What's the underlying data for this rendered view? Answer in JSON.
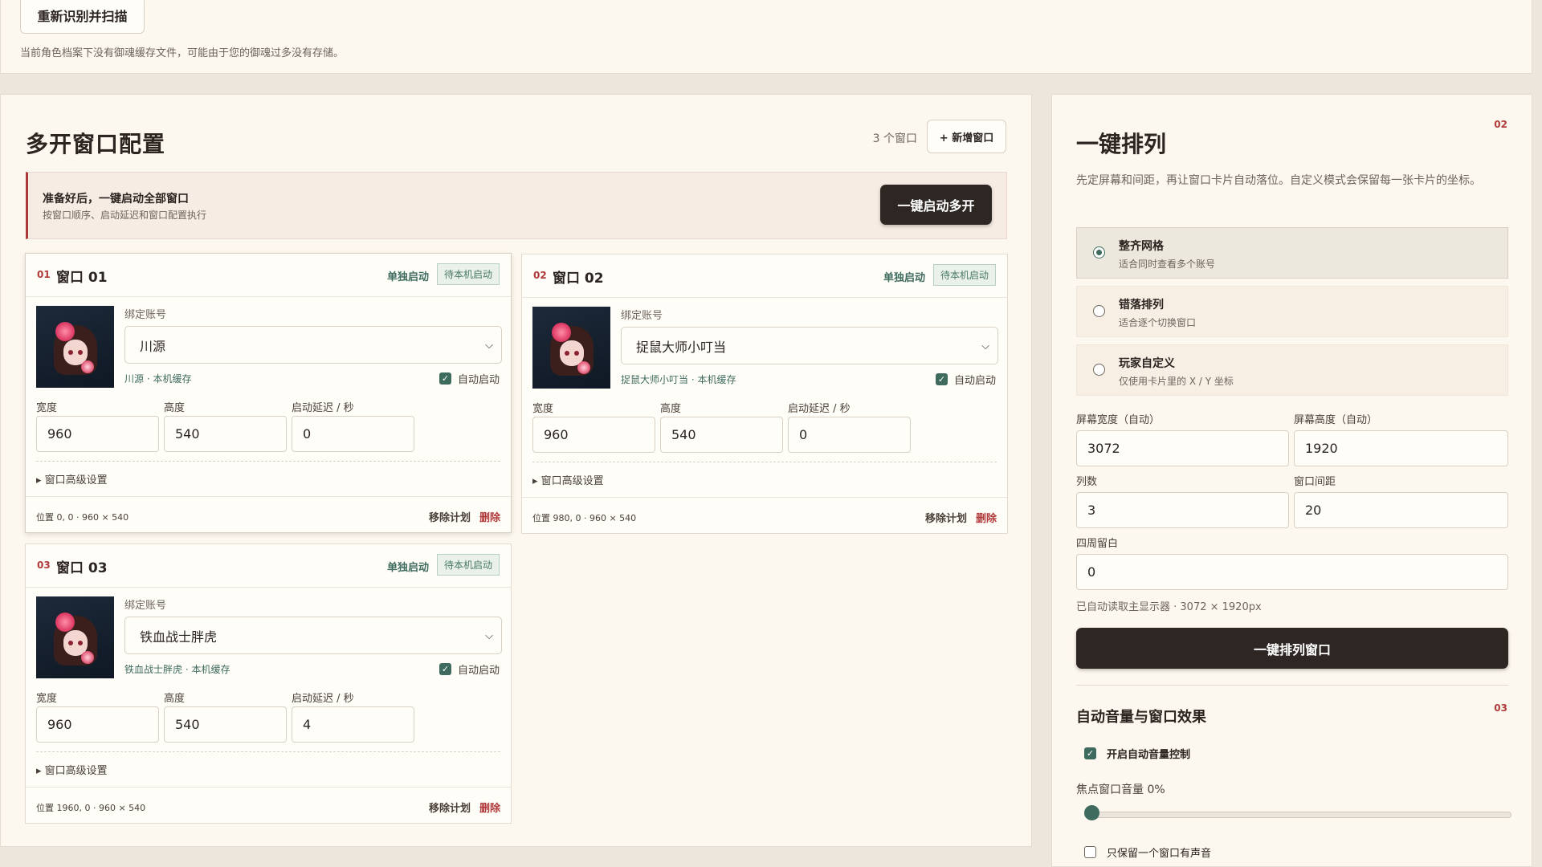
{
  "top": {
    "rescan_label": "重新识别并扫描",
    "note": "当前角色档案下没有御魂缓存文件，可能由于您的御魂过多没有存储。"
  },
  "main": {
    "title": "多开窗口配置",
    "window_count": "3 个窗口",
    "add_window_label": "+ 新增窗口",
    "banner": {
      "title": "准备好后，一键启动全部窗口",
      "subtitle": "按窗口顺序、启动延迟和窗口配置执行",
      "button": "一键启动多开"
    },
    "labels": {
      "solo_launch": "单独启动",
      "wait_badge": "待本机启动",
      "bind_account": "绑定账号",
      "auto_start": "自动启动",
      "width": "宽度",
      "height": "高度",
      "delay": "启动延迟 / 秒",
      "advanced": "▸ 窗口高级设置",
      "remove_plan": "移除计划",
      "delete": "删除"
    },
    "windows": [
      {
        "no": "01",
        "name": "窗口 01",
        "account": "川源",
        "meta": "川源 · 本机缓存",
        "auto_start": true,
        "width": "960",
        "height": "540",
        "delay": "0",
        "position": "位置 0, 0 · 960 × 540"
      },
      {
        "no": "02",
        "name": "窗口 02",
        "account": "捉鼠大师小叮当",
        "meta": "捉鼠大师小叮当 · 本机缓存",
        "auto_start": true,
        "width": "960",
        "height": "540",
        "delay": "0",
        "position": "位置 980, 0 · 960 × 540"
      },
      {
        "no": "03",
        "name": "窗口 03",
        "account": "铁血战士胖虎",
        "meta": "铁血战士胖虎 · 本机缓存",
        "auto_start": true,
        "width": "960",
        "height": "540",
        "delay": "4",
        "position": "位置 1960, 0 · 960 × 540"
      }
    ]
  },
  "arrange": {
    "section_no": "02",
    "title": "一键排列",
    "description": "先定屏幕和间距，再让窗口卡片自动落位。自定义模式会保留每一张卡片的坐标。",
    "options": [
      {
        "title": "整齐网格",
        "subtitle": "适合同时查看多个账号",
        "selected": true
      },
      {
        "title": "错落排列",
        "subtitle": "适合逐个切换窗口",
        "selected": false
      },
      {
        "title": "玩家自定义",
        "subtitle": "仅使用卡片里的 X / Y 坐标",
        "selected": false
      }
    ],
    "screen_width_label": "屏幕宽度（自动）",
    "screen_width": "3072",
    "screen_height_label": "屏幕高度（自动）",
    "screen_height": "1920",
    "columns_label": "列数",
    "columns": "3",
    "gap_label": "窗口间距",
    "gap": "20",
    "margin_label": "四周留白",
    "margin": "0",
    "screen_note": "已自动读取主显示器 · 3072 × 1920px",
    "arrange_button": "一键排列窗口"
  },
  "audio": {
    "section_no": "03",
    "title": "自动音量与窗口效果",
    "enable_label": "开启自动音量控制",
    "enable_checked": true,
    "focus_volume_label": "焦点窗口音量 0%",
    "focus_volume_percent": 0,
    "only_one_label": "只保留一个窗口有声音",
    "only_one_checked": false
  },
  "colors": {
    "accent_green": "#3e6b5e",
    "accent_red": "#b03a3a",
    "dark_button": "#2d2622",
    "panel_bg": "#fcf7ef"
  }
}
